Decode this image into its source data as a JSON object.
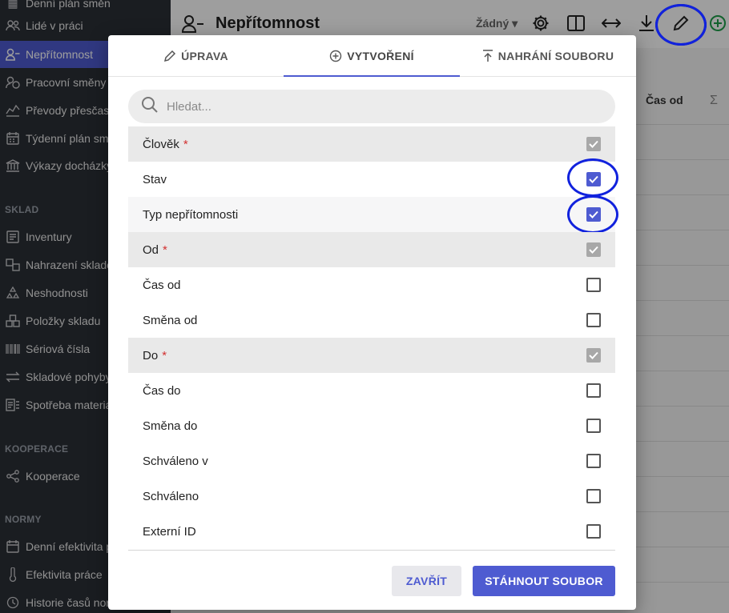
{
  "sidebar": {
    "items": [
      {
        "label": "Denní plán směn",
        "icon": "calendar-icon"
      },
      {
        "label": "Lidé v práci",
        "icon": "people-icon"
      },
      {
        "label": "Nepřítomnost",
        "icon": "person-minus-icon",
        "active": true
      },
      {
        "label": "Pracovní směny",
        "icon": "person-clock-icon"
      },
      {
        "label": "Převody přesčasů",
        "icon": "transfer-icon"
      },
      {
        "label": "Týdenní plán směn",
        "icon": "calendar-week-icon"
      },
      {
        "label": "Výkazy docházky",
        "icon": "bank-icon"
      },
      {
        "label": "Inventury",
        "icon": "inventory-icon"
      },
      {
        "label": "Nahrazení skladových",
        "icon": "swap-icon"
      },
      {
        "label": "Neshodnosti",
        "icon": "recycle-icon"
      },
      {
        "label": "Položky skladu",
        "icon": "boxes-icon"
      },
      {
        "label": "Sériová čísla",
        "icon": "barcode-icon"
      },
      {
        "label": "Skladové pohyby",
        "icon": "arrows-icon"
      },
      {
        "label": "Spotřeba materiálu",
        "icon": "list-icon"
      },
      {
        "label": "Kooperace",
        "icon": "share-icon"
      },
      {
        "label": "Denní efektivita práce",
        "icon": "calendar-icon"
      },
      {
        "label": "Efektivita práce",
        "icon": "thermometer-icon"
      },
      {
        "label": "Historie časů norem",
        "icon": "history-icon"
      }
    ],
    "sections": [
      "SKLAD",
      "KOOPERACE",
      "NORMY"
    ]
  },
  "header": {
    "title": "Nepřítomnost",
    "filter_label": "Žádný"
  },
  "background_table": {
    "column_time_from": "Čas od",
    "sigma": "Σ"
  },
  "modal": {
    "tabs": [
      {
        "label": "ÚPRAVA",
        "icon": "pencil-icon"
      },
      {
        "label": "VYTVOŘENÍ",
        "icon": "plus-circle-icon",
        "active": true
      },
      {
        "label": "NAHRÁNÍ SOUBORU",
        "icon": "upload-icon"
      }
    ],
    "search_placeholder": "Hledat...",
    "fields": [
      {
        "label": "Člověk",
        "required": true,
        "checked": true,
        "disabled": true
      },
      {
        "label": "Stav",
        "required": false,
        "checked": true,
        "disabled": false
      },
      {
        "label": "Typ nepřítomnosti",
        "required": false,
        "checked": true,
        "disabled": false
      },
      {
        "label": "Od",
        "required": true,
        "checked": true,
        "disabled": true
      },
      {
        "label": "Čas od",
        "required": false,
        "checked": false,
        "disabled": false
      },
      {
        "label": "Směna od",
        "required": false,
        "checked": false,
        "disabled": false
      },
      {
        "label": "Do",
        "required": true,
        "checked": true,
        "disabled": true
      },
      {
        "label": "Čas do",
        "required": false,
        "checked": false,
        "disabled": false
      },
      {
        "label": "Směna do",
        "required": false,
        "checked": false,
        "disabled": false
      },
      {
        "label": "Schváleno v",
        "required": false,
        "checked": false,
        "disabled": false
      },
      {
        "label": "Schváleno",
        "required": false,
        "checked": false,
        "disabled": false
      },
      {
        "label": "Externí ID",
        "required": false,
        "checked": false,
        "disabled": false
      }
    ],
    "required_mark": "*",
    "buttons": {
      "close": "ZAVŘÍT",
      "download": "STÁHNOUT SOUBOR"
    }
  },
  "colors": {
    "accent": "#4e5bd1",
    "sidebar_bg": "#2b2f36",
    "annotation_circle": "#1122dd",
    "required_star": "#d23030"
  }
}
